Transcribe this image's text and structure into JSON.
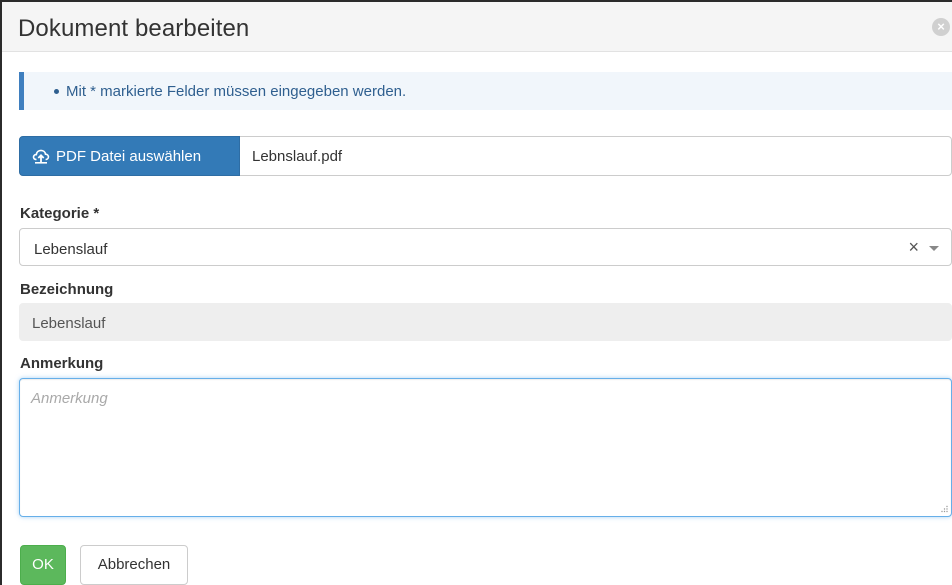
{
  "dialog": {
    "title": "Dokument bearbeiten",
    "close_icon": "close-circle-icon"
  },
  "info": {
    "message": "Mit * markierte Felder müssen eingegeben werden."
  },
  "file": {
    "button_label": "PDF Datei auswählen",
    "button_icon": "cloud-upload-icon",
    "file_name": "Lebnslauf.pdf"
  },
  "fields": {
    "kategorie": {
      "label": "Kategorie *",
      "value": "Lebenslauf",
      "clear_glyph": "×"
    },
    "bezeichnung": {
      "label": "Bezeichnung",
      "value": "Lebenslauf"
    },
    "anmerkung": {
      "label": "Anmerkung",
      "placeholder": "Anmerkung",
      "value": ""
    }
  },
  "actions": {
    "ok_label": "OK",
    "cancel_label": "Abbrechen"
  },
  "colors": {
    "primary": "#337ab7",
    "success": "#5cb85c",
    "info_border": "#3f7fbf",
    "info_text": "#2f5f8f",
    "focus_border": "#66afe9"
  }
}
